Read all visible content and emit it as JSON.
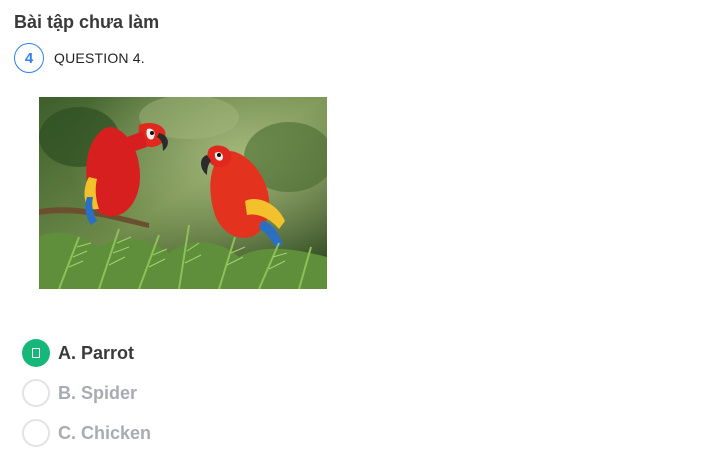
{
  "section": {
    "title": "Bài tập chưa làm"
  },
  "question": {
    "number": "4",
    "label": "QUESTION 4."
  },
  "image": {
    "alt": "Two red macaws on a branch"
  },
  "answers": [
    {
      "label": "A. Parrot",
      "selected": true
    },
    {
      "label": "B. Spider",
      "selected": false
    },
    {
      "label": "C. Chicken",
      "selected": false
    }
  ],
  "colors": {
    "accent": "#2f80ed",
    "selected": "#16b779",
    "muted": "#a8abb3"
  }
}
